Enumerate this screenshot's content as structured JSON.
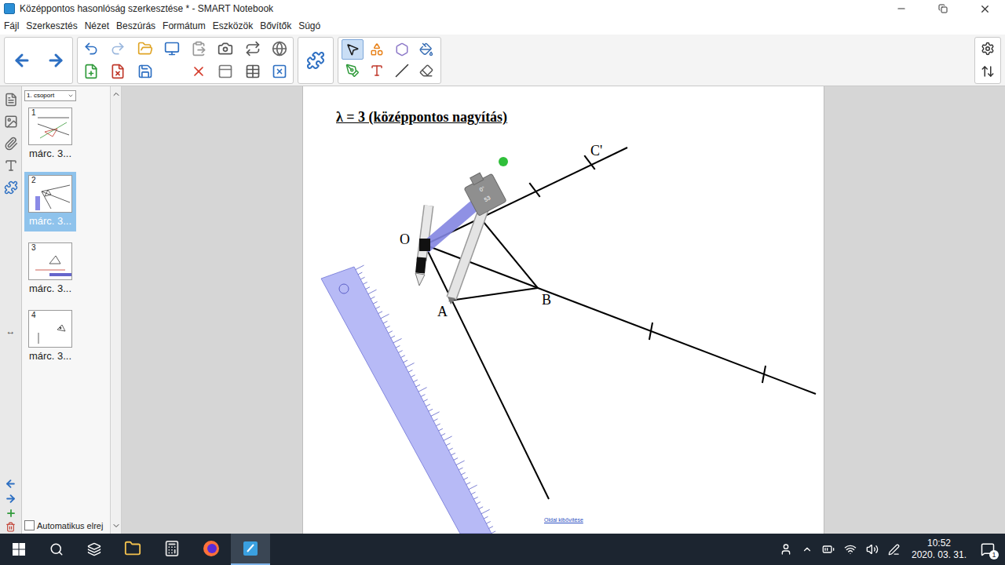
{
  "window": {
    "title": "Középpontos hasonlóság szerkesztése * - SMART Notebook"
  },
  "menu": [
    "Fájl",
    "Szerkesztés",
    "Nézet",
    "Beszúrás",
    "Formátum",
    "Eszközök",
    "Bővítők",
    "Súgó"
  ],
  "toolbar": {
    "tools": [
      {
        "kind": "select",
        "selected": true
      },
      {
        "kind": "shapes",
        "selected": false
      },
      {
        "kind": "polygon",
        "selected": false
      },
      {
        "kind": "fill",
        "selected": false
      },
      {
        "kind": "pens",
        "selected": false
      },
      {
        "kind": "text",
        "selected": false
      },
      {
        "kind": "line",
        "selected": false
      },
      {
        "kind": "eraser",
        "selected": false
      }
    ]
  },
  "side_tabs": {
    "resize_glyph": "↔"
  },
  "page_sorter": {
    "group": "1. csoport",
    "pages": [
      {
        "number": "1",
        "label": "márc. 3...",
        "selected": false
      },
      {
        "number": "2",
        "label": "márc. 3...",
        "selected": true
      },
      {
        "number": "3",
        "label": "márc. 3...",
        "selected": false
      },
      {
        "number": "4",
        "label": "márc. 3...",
        "selected": false
      }
    ],
    "auto_hide": {
      "label": "Automatikus elrej",
      "checked": false
    }
  },
  "page": {
    "title": "λ = 3 (középpontos nagyítás)",
    "points": [
      {
        "label": "O"
      },
      {
        "label": "A"
      },
      {
        "label": "B"
      },
      {
        "label": "C'"
      }
    ],
    "compass": {
      "angle": "0°",
      "reading": "53"
    },
    "extend_link": "Oldal kibővítése"
  },
  "taskbar": {
    "apps": [
      {
        "kind": "explorer",
        "selected": false
      },
      {
        "kind": "calculator",
        "selected": false
      },
      {
        "kind": "firefox",
        "selected": false
      },
      {
        "kind": "notebook",
        "selected": true
      }
    ],
    "time": "10:52",
    "date": "2020. 03. 31.",
    "notifications": "1"
  }
}
